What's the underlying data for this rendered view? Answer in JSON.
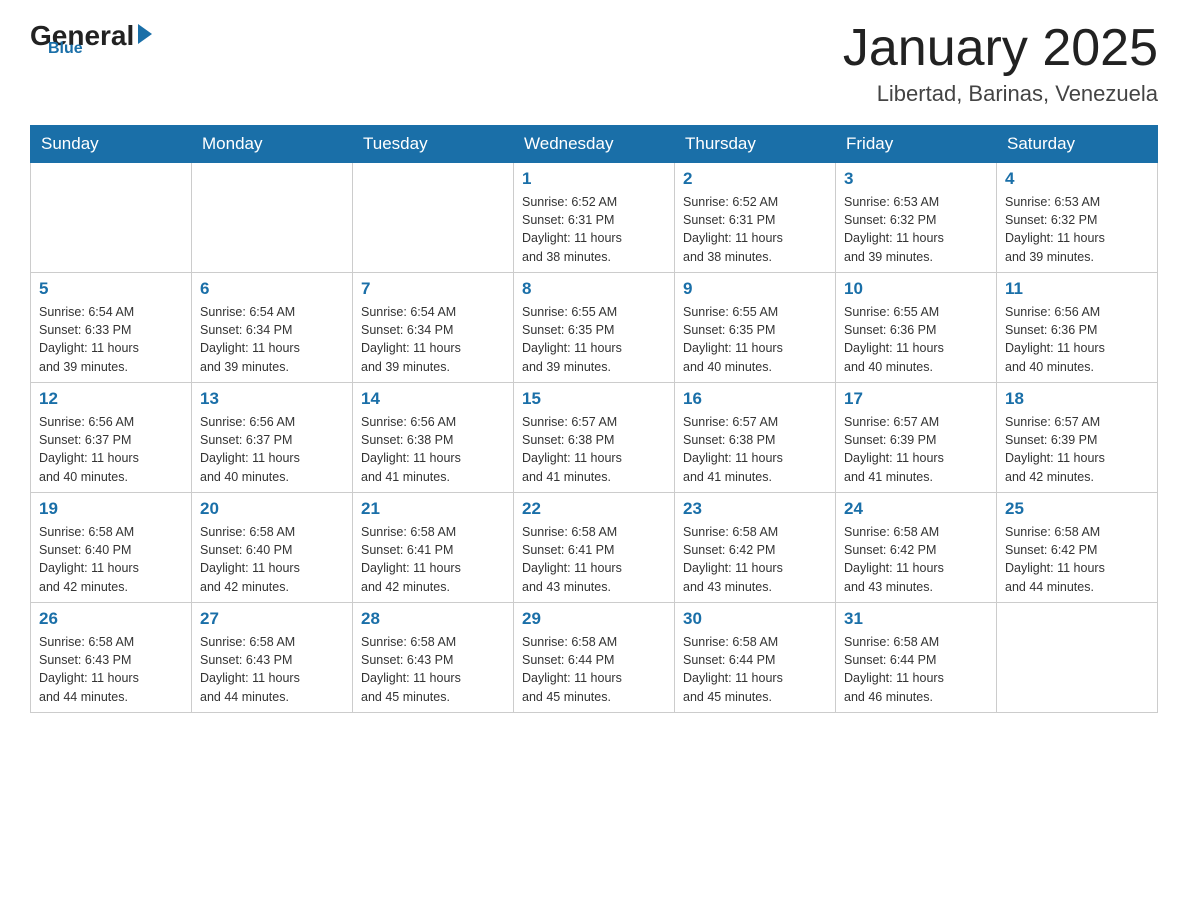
{
  "header": {
    "logo_general": "General",
    "logo_blue": "Blue",
    "title": "January 2025",
    "subtitle": "Libertad, Barinas, Venezuela"
  },
  "days_of_week": [
    "Sunday",
    "Monday",
    "Tuesday",
    "Wednesday",
    "Thursday",
    "Friday",
    "Saturday"
  ],
  "weeks": [
    [
      {
        "day": "",
        "info": ""
      },
      {
        "day": "",
        "info": ""
      },
      {
        "day": "",
        "info": ""
      },
      {
        "day": "1",
        "info": "Sunrise: 6:52 AM\nSunset: 6:31 PM\nDaylight: 11 hours\nand 38 minutes."
      },
      {
        "day": "2",
        "info": "Sunrise: 6:52 AM\nSunset: 6:31 PM\nDaylight: 11 hours\nand 38 minutes."
      },
      {
        "day": "3",
        "info": "Sunrise: 6:53 AM\nSunset: 6:32 PM\nDaylight: 11 hours\nand 39 minutes."
      },
      {
        "day": "4",
        "info": "Sunrise: 6:53 AM\nSunset: 6:32 PM\nDaylight: 11 hours\nand 39 minutes."
      }
    ],
    [
      {
        "day": "5",
        "info": "Sunrise: 6:54 AM\nSunset: 6:33 PM\nDaylight: 11 hours\nand 39 minutes."
      },
      {
        "day": "6",
        "info": "Sunrise: 6:54 AM\nSunset: 6:34 PM\nDaylight: 11 hours\nand 39 minutes."
      },
      {
        "day": "7",
        "info": "Sunrise: 6:54 AM\nSunset: 6:34 PM\nDaylight: 11 hours\nand 39 minutes."
      },
      {
        "day": "8",
        "info": "Sunrise: 6:55 AM\nSunset: 6:35 PM\nDaylight: 11 hours\nand 39 minutes."
      },
      {
        "day": "9",
        "info": "Sunrise: 6:55 AM\nSunset: 6:35 PM\nDaylight: 11 hours\nand 40 minutes."
      },
      {
        "day": "10",
        "info": "Sunrise: 6:55 AM\nSunset: 6:36 PM\nDaylight: 11 hours\nand 40 minutes."
      },
      {
        "day": "11",
        "info": "Sunrise: 6:56 AM\nSunset: 6:36 PM\nDaylight: 11 hours\nand 40 minutes."
      }
    ],
    [
      {
        "day": "12",
        "info": "Sunrise: 6:56 AM\nSunset: 6:37 PM\nDaylight: 11 hours\nand 40 minutes."
      },
      {
        "day": "13",
        "info": "Sunrise: 6:56 AM\nSunset: 6:37 PM\nDaylight: 11 hours\nand 40 minutes."
      },
      {
        "day": "14",
        "info": "Sunrise: 6:56 AM\nSunset: 6:38 PM\nDaylight: 11 hours\nand 41 minutes."
      },
      {
        "day": "15",
        "info": "Sunrise: 6:57 AM\nSunset: 6:38 PM\nDaylight: 11 hours\nand 41 minutes."
      },
      {
        "day": "16",
        "info": "Sunrise: 6:57 AM\nSunset: 6:38 PM\nDaylight: 11 hours\nand 41 minutes."
      },
      {
        "day": "17",
        "info": "Sunrise: 6:57 AM\nSunset: 6:39 PM\nDaylight: 11 hours\nand 41 minutes."
      },
      {
        "day": "18",
        "info": "Sunrise: 6:57 AM\nSunset: 6:39 PM\nDaylight: 11 hours\nand 42 minutes."
      }
    ],
    [
      {
        "day": "19",
        "info": "Sunrise: 6:58 AM\nSunset: 6:40 PM\nDaylight: 11 hours\nand 42 minutes."
      },
      {
        "day": "20",
        "info": "Sunrise: 6:58 AM\nSunset: 6:40 PM\nDaylight: 11 hours\nand 42 minutes."
      },
      {
        "day": "21",
        "info": "Sunrise: 6:58 AM\nSunset: 6:41 PM\nDaylight: 11 hours\nand 42 minutes."
      },
      {
        "day": "22",
        "info": "Sunrise: 6:58 AM\nSunset: 6:41 PM\nDaylight: 11 hours\nand 43 minutes."
      },
      {
        "day": "23",
        "info": "Sunrise: 6:58 AM\nSunset: 6:42 PM\nDaylight: 11 hours\nand 43 minutes."
      },
      {
        "day": "24",
        "info": "Sunrise: 6:58 AM\nSunset: 6:42 PM\nDaylight: 11 hours\nand 43 minutes."
      },
      {
        "day": "25",
        "info": "Sunrise: 6:58 AM\nSunset: 6:42 PM\nDaylight: 11 hours\nand 44 minutes."
      }
    ],
    [
      {
        "day": "26",
        "info": "Sunrise: 6:58 AM\nSunset: 6:43 PM\nDaylight: 11 hours\nand 44 minutes."
      },
      {
        "day": "27",
        "info": "Sunrise: 6:58 AM\nSunset: 6:43 PM\nDaylight: 11 hours\nand 44 minutes."
      },
      {
        "day": "28",
        "info": "Sunrise: 6:58 AM\nSunset: 6:43 PM\nDaylight: 11 hours\nand 45 minutes."
      },
      {
        "day": "29",
        "info": "Sunrise: 6:58 AM\nSunset: 6:44 PM\nDaylight: 11 hours\nand 45 minutes."
      },
      {
        "day": "30",
        "info": "Sunrise: 6:58 AM\nSunset: 6:44 PM\nDaylight: 11 hours\nand 45 minutes."
      },
      {
        "day": "31",
        "info": "Sunrise: 6:58 AM\nSunset: 6:44 PM\nDaylight: 11 hours\nand 46 minutes."
      },
      {
        "day": "",
        "info": ""
      }
    ]
  ]
}
